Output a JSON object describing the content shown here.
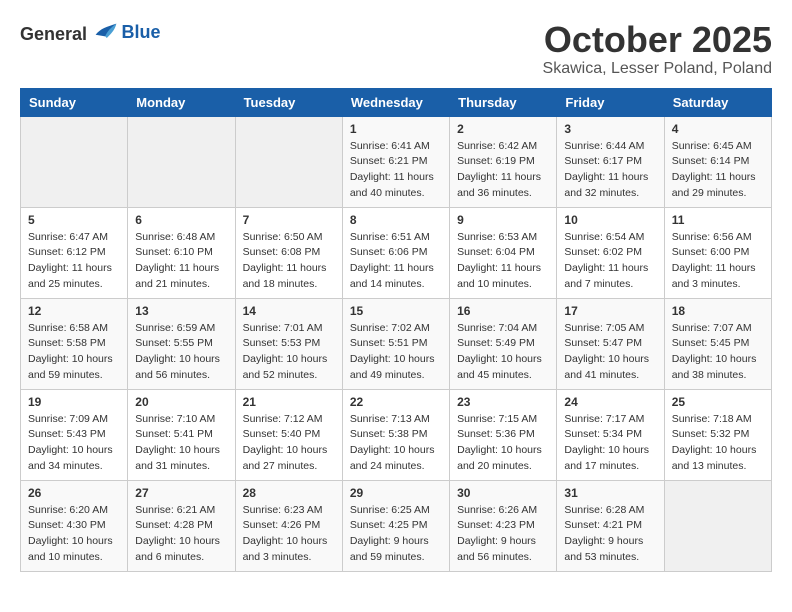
{
  "header": {
    "logo_general": "General",
    "logo_blue": "Blue",
    "month": "October 2025",
    "location": "Skawica, Lesser Poland, Poland"
  },
  "days_of_week": [
    "Sunday",
    "Monday",
    "Tuesday",
    "Wednesday",
    "Thursday",
    "Friday",
    "Saturday"
  ],
  "weeks": [
    [
      {
        "day": "",
        "info": ""
      },
      {
        "day": "",
        "info": ""
      },
      {
        "day": "",
        "info": ""
      },
      {
        "day": "1",
        "info": "Sunrise: 6:41 AM\nSunset: 6:21 PM\nDaylight: 11 hours\nand 40 minutes."
      },
      {
        "day": "2",
        "info": "Sunrise: 6:42 AM\nSunset: 6:19 PM\nDaylight: 11 hours\nand 36 minutes."
      },
      {
        "day": "3",
        "info": "Sunrise: 6:44 AM\nSunset: 6:17 PM\nDaylight: 11 hours\nand 32 minutes."
      },
      {
        "day": "4",
        "info": "Sunrise: 6:45 AM\nSunset: 6:14 PM\nDaylight: 11 hours\nand 29 minutes."
      }
    ],
    [
      {
        "day": "5",
        "info": "Sunrise: 6:47 AM\nSunset: 6:12 PM\nDaylight: 11 hours\nand 25 minutes."
      },
      {
        "day": "6",
        "info": "Sunrise: 6:48 AM\nSunset: 6:10 PM\nDaylight: 11 hours\nand 21 minutes."
      },
      {
        "day": "7",
        "info": "Sunrise: 6:50 AM\nSunset: 6:08 PM\nDaylight: 11 hours\nand 18 minutes."
      },
      {
        "day": "8",
        "info": "Sunrise: 6:51 AM\nSunset: 6:06 PM\nDaylight: 11 hours\nand 14 minutes."
      },
      {
        "day": "9",
        "info": "Sunrise: 6:53 AM\nSunset: 6:04 PM\nDaylight: 11 hours\nand 10 minutes."
      },
      {
        "day": "10",
        "info": "Sunrise: 6:54 AM\nSunset: 6:02 PM\nDaylight: 11 hours\nand 7 minutes."
      },
      {
        "day": "11",
        "info": "Sunrise: 6:56 AM\nSunset: 6:00 PM\nDaylight: 11 hours\nand 3 minutes."
      }
    ],
    [
      {
        "day": "12",
        "info": "Sunrise: 6:58 AM\nSunset: 5:58 PM\nDaylight: 10 hours\nand 59 minutes."
      },
      {
        "day": "13",
        "info": "Sunrise: 6:59 AM\nSunset: 5:55 PM\nDaylight: 10 hours\nand 56 minutes."
      },
      {
        "day": "14",
        "info": "Sunrise: 7:01 AM\nSunset: 5:53 PM\nDaylight: 10 hours\nand 52 minutes."
      },
      {
        "day": "15",
        "info": "Sunrise: 7:02 AM\nSunset: 5:51 PM\nDaylight: 10 hours\nand 49 minutes."
      },
      {
        "day": "16",
        "info": "Sunrise: 7:04 AM\nSunset: 5:49 PM\nDaylight: 10 hours\nand 45 minutes."
      },
      {
        "day": "17",
        "info": "Sunrise: 7:05 AM\nSunset: 5:47 PM\nDaylight: 10 hours\nand 41 minutes."
      },
      {
        "day": "18",
        "info": "Sunrise: 7:07 AM\nSunset: 5:45 PM\nDaylight: 10 hours\nand 38 minutes."
      }
    ],
    [
      {
        "day": "19",
        "info": "Sunrise: 7:09 AM\nSunset: 5:43 PM\nDaylight: 10 hours\nand 34 minutes."
      },
      {
        "day": "20",
        "info": "Sunrise: 7:10 AM\nSunset: 5:41 PM\nDaylight: 10 hours\nand 31 minutes."
      },
      {
        "day": "21",
        "info": "Sunrise: 7:12 AM\nSunset: 5:40 PM\nDaylight: 10 hours\nand 27 minutes."
      },
      {
        "day": "22",
        "info": "Sunrise: 7:13 AM\nSunset: 5:38 PM\nDaylight: 10 hours\nand 24 minutes."
      },
      {
        "day": "23",
        "info": "Sunrise: 7:15 AM\nSunset: 5:36 PM\nDaylight: 10 hours\nand 20 minutes."
      },
      {
        "day": "24",
        "info": "Sunrise: 7:17 AM\nSunset: 5:34 PM\nDaylight: 10 hours\nand 17 minutes."
      },
      {
        "day": "25",
        "info": "Sunrise: 7:18 AM\nSunset: 5:32 PM\nDaylight: 10 hours\nand 13 minutes."
      }
    ],
    [
      {
        "day": "26",
        "info": "Sunrise: 6:20 AM\nSunset: 4:30 PM\nDaylight: 10 hours\nand 10 minutes."
      },
      {
        "day": "27",
        "info": "Sunrise: 6:21 AM\nSunset: 4:28 PM\nDaylight: 10 hours\nand 6 minutes."
      },
      {
        "day": "28",
        "info": "Sunrise: 6:23 AM\nSunset: 4:26 PM\nDaylight: 10 hours\nand 3 minutes."
      },
      {
        "day": "29",
        "info": "Sunrise: 6:25 AM\nSunset: 4:25 PM\nDaylight: 9 hours\nand 59 minutes."
      },
      {
        "day": "30",
        "info": "Sunrise: 6:26 AM\nSunset: 4:23 PM\nDaylight: 9 hours\nand 56 minutes."
      },
      {
        "day": "31",
        "info": "Sunrise: 6:28 AM\nSunset: 4:21 PM\nDaylight: 9 hours\nand 53 minutes."
      },
      {
        "day": "",
        "info": ""
      }
    ]
  ]
}
